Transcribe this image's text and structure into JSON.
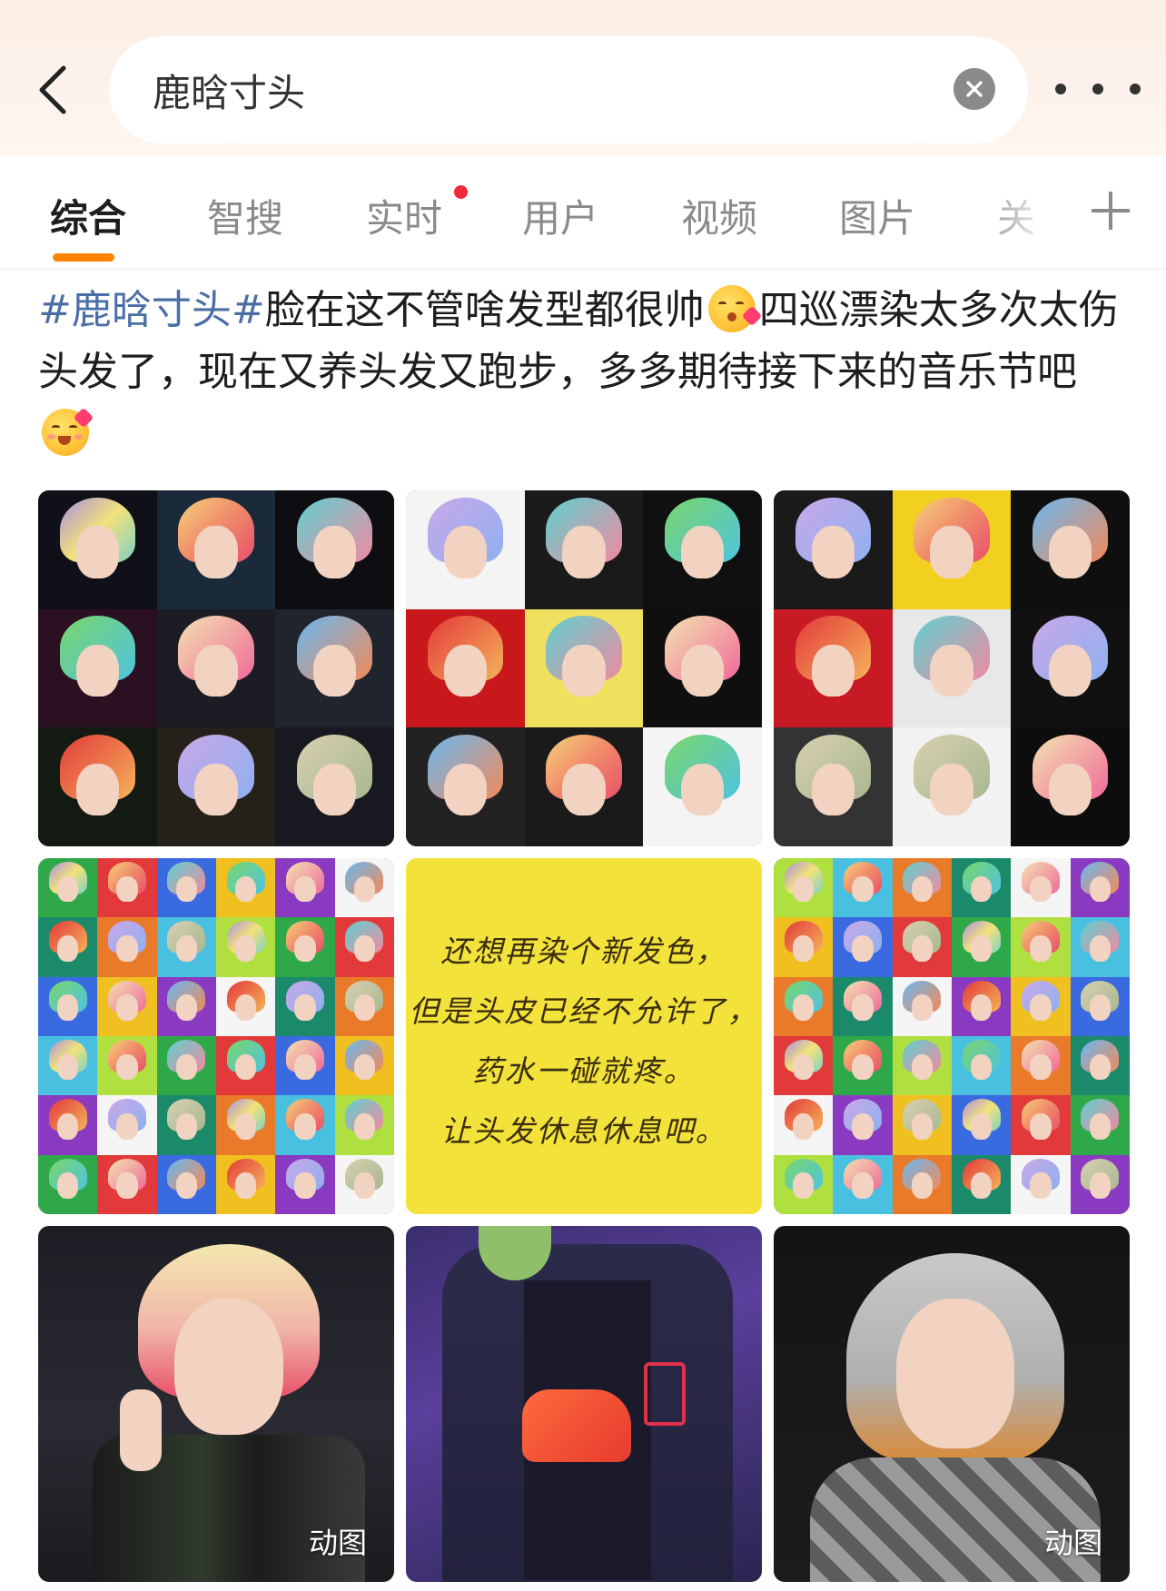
{
  "search": {
    "query": "鹿晗寸头"
  },
  "icons": {
    "back": "chevron-left-icon",
    "clear": "close-circle-icon",
    "more": "more-horizontal-icon",
    "add_tab": "plus-icon"
  },
  "tabs": [
    {
      "label": "综合",
      "active": true
    },
    {
      "label": "智搜",
      "active": false
    },
    {
      "label": "实时",
      "active": false,
      "has_dot": true
    },
    {
      "label": "用户",
      "active": false
    },
    {
      "label": "视频",
      "active": false
    },
    {
      "label": "图片",
      "active": false
    },
    {
      "label": "关",
      "active": false
    }
  ],
  "colors": {
    "accent": "#ff8200",
    "hashtag": "#4a6ea6",
    "notification_dot": "#f0293c"
  },
  "post": {
    "hashtag": "#鹿晗寸头#",
    "text_1": "脸在这不管啥发型都很帅",
    "text_2": "四巡漂染太多次太伤头发了，现在又养头发又跑步，多多期待接下来的音乐节吧",
    "emoji_1": "face-blowing-kiss-emoji",
    "emoji_2": "smiling-face-with-hearts-emoji"
  },
  "images": [
    {
      "kind": "collage",
      "name": "colorful-hair-collage-1"
    },
    {
      "kind": "collage",
      "name": "colorful-hair-collage-2"
    },
    {
      "kind": "collage",
      "name": "colorful-hair-collage-3"
    },
    {
      "kind": "mosaic",
      "name": "outfit-mosaic-1"
    },
    {
      "kind": "note",
      "name": "handwritten-note",
      "lines": [
        "还想再染个新发色，",
        "但是头皮已经不允许了，",
        "药水一碰就疼。",
        "让头发休息休息吧。"
      ]
    },
    {
      "kind": "mosaic",
      "name": "outfit-mosaic-2"
    },
    {
      "kind": "photo",
      "name": "peace-sign-photo",
      "badge": "动图"
    },
    {
      "kind": "photo",
      "name": "jersey-photo"
    },
    {
      "kind": "photo",
      "name": "silver-hair-photo",
      "badge": "动图"
    }
  ]
}
